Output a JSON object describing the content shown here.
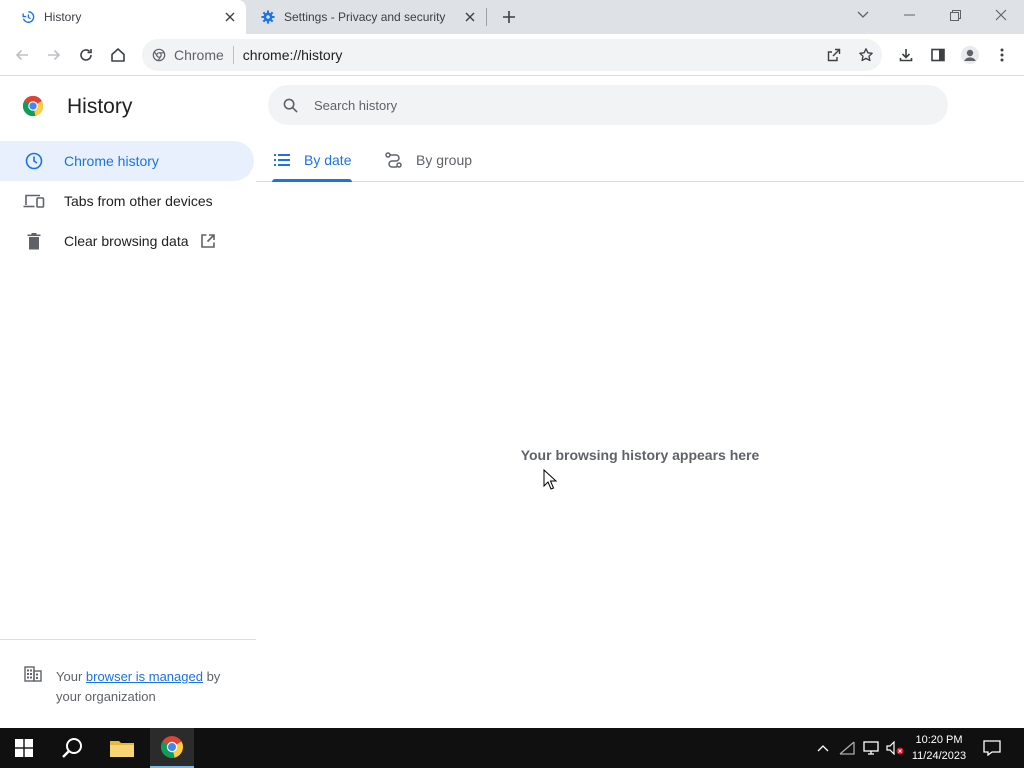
{
  "tabs": [
    {
      "title": "History",
      "icon": "history-icon",
      "active": true
    },
    {
      "title": "Settings - Privacy and security",
      "icon": "gear-icon",
      "active": false
    }
  ],
  "omnibox": {
    "site_name": "Chrome",
    "url": "chrome://history"
  },
  "page": {
    "title": "History",
    "search_placeholder": "Search history",
    "nav": [
      {
        "label": "Chrome history",
        "icon": "clock-icon",
        "selected": true
      },
      {
        "label": "Tabs from other devices",
        "icon": "devices-icon",
        "selected": false
      },
      {
        "label": "Clear browsing data",
        "icon": "trash-icon",
        "selected": false
      }
    ],
    "view_tabs": [
      {
        "label": "By date",
        "icon": "list-icon",
        "active": true
      },
      {
        "label": "By group",
        "icon": "group-icon",
        "active": false
      }
    ],
    "empty_message": "Your browsing history appears here",
    "managed": {
      "prefix": "Your ",
      "link": "browser is managed",
      "suffix": " by your organization"
    }
  },
  "taskbar": {
    "time": "10:20 PM",
    "date": "11/24/2023"
  },
  "colors": {
    "accent": "#1a73e8",
    "tabstrip": "#dee1e6",
    "omnibox": "#f1f3f4",
    "selected_nav": "#e8f0fe",
    "taskbar": "#101010"
  }
}
